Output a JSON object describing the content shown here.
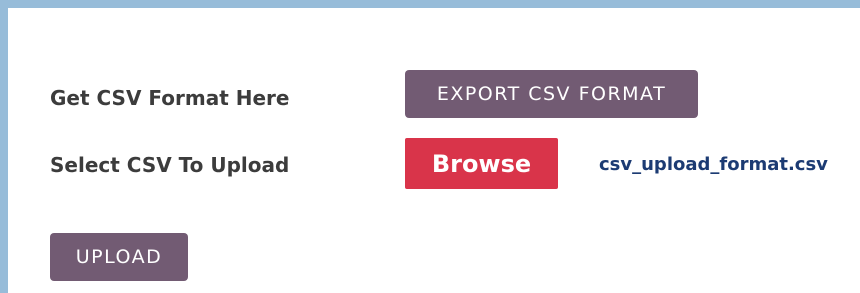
{
  "form": {
    "format_label": "Get CSV Format Here",
    "export_button": "EXPORT CSV FORMAT",
    "select_label": "Select CSV To Upload",
    "browse_button": "Browse",
    "selected_file": "csv_upload_format.csv",
    "upload_button": "UPLOAD"
  },
  "colors": {
    "frame_border": "#97bcd9",
    "primary_button": "#725b73",
    "browse_button": "#d9344a",
    "filename_text": "#1c3b73",
    "label_text": "#3c3c3c"
  }
}
